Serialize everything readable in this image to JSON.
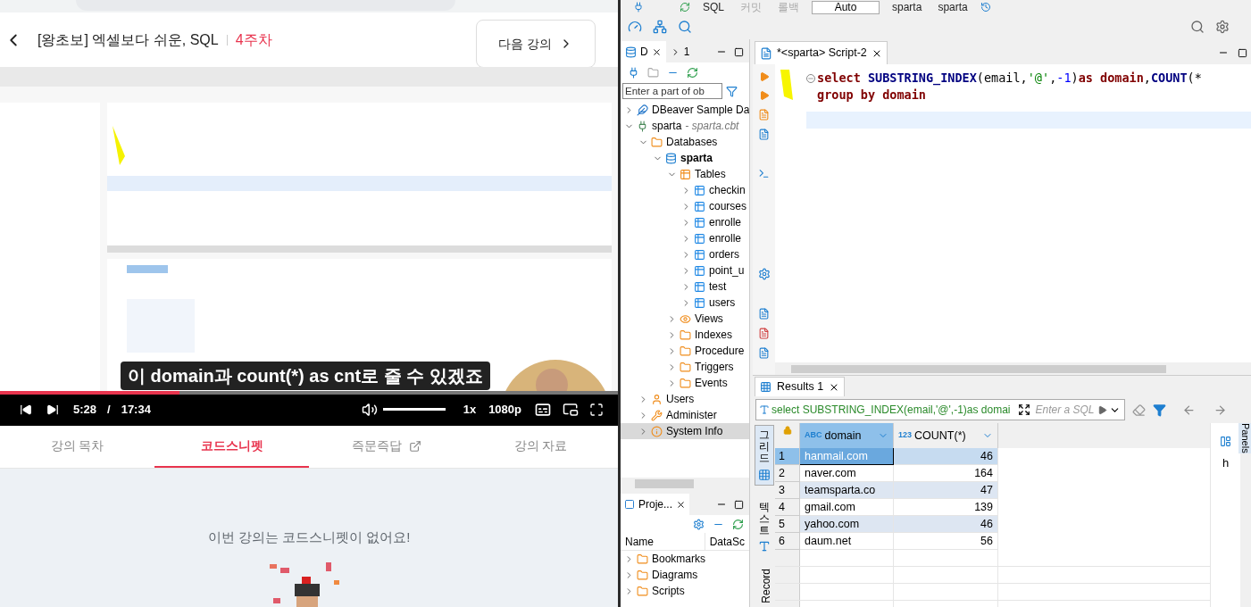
{
  "course_header": {
    "title": "[왕초보] 엑셀보다 쉬운, SQL",
    "week": "4주차",
    "next_button": "다음 강의"
  },
  "player": {
    "subtitle": "이 domain과 count(*) as cnt로 줄 수 있겠죠",
    "progress": {
      "level": 0.29
    },
    "current_time": "5:28",
    "separator": "/",
    "duration": "17:34",
    "volume": {
      "level": 1
    },
    "speed": "1x",
    "quality": "1080p"
  },
  "lecture_tabs": [
    {
      "label": "강의 목차",
      "selected": false,
      "external": false
    },
    {
      "label": "코드스니펫",
      "selected": true,
      "external": false
    },
    {
      "label": "즉문즉답",
      "selected": false,
      "external": true
    },
    {
      "label": "강의 자료",
      "selected": false,
      "external": false
    }
  ],
  "empty_message": "이번 강의는 코드스니펫이 없어요!",
  "dbeaver": {
    "toolbar": [
      {
        "label": "SQL",
        "kind": "button"
      },
      {
        "label": "커밋",
        "kind": "disabled"
      },
      {
        "label": "롤백",
        "kind": "disabled"
      },
      {
        "label": "Auto",
        "kind": "field"
      },
      {
        "label": "sparta",
        "kind": "button"
      },
      {
        "label": "sparta",
        "kind": "button"
      }
    ],
    "navigator": {
      "tabs": [
        {
          "label": "D",
          "selected": true
        },
        {
          "label": "1",
          "selected": false
        }
      ],
      "filter_placeholder": "Enter a part of ob",
      "tree": [
        {
          "label": "DBeaver Sample Da",
          "kind": "sample",
          "expanded": false,
          "selected": false
        },
        {
          "label": "sparta",
          "detail": "- sparta.cbt",
          "kind": "connection",
          "expanded": true,
          "selected": false,
          "children": [
            {
              "label": "Databases",
              "kind": "databases",
              "expanded": true,
              "selected": false,
              "children": [
                {
                  "label": "sparta",
                  "kind": "database",
                  "expanded": true,
                  "selected": false,
                  "children": [
                    {
                      "label": "Tables",
                      "kind": "tables",
                      "expanded": true,
                      "selected": false,
                      "children": [
                        {
                          "label": "checkin",
                          "kind": "table",
                          "expanded": false,
                          "selected": false
                        },
                        {
                          "label": "courses",
                          "kind": "table",
                          "expanded": false,
                          "selected": false
                        },
                        {
                          "label": "enrolle",
                          "kind": "table",
                          "expanded": false,
                          "selected": false
                        },
                        {
                          "label": "enrolle",
                          "kind": "table",
                          "expanded": false,
                          "selected": false
                        },
                        {
                          "label": "orders",
                          "kind": "table",
                          "expanded": false,
                          "selected": false
                        },
                        {
                          "label": "point_u",
                          "kind": "table",
                          "expanded": false,
                          "selected": false
                        },
                        {
                          "label": "test",
                          "kind": "table",
                          "expanded": false,
                          "selected": false
                        },
                        {
                          "label": "users",
                          "kind": "table",
                          "expanded": false,
                          "selected": false
                        }
                      ]
                    },
                    {
                      "label": "Views",
                      "kind": "views",
                      "expanded": false,
                      "selected": false
                    },
                    {
                      "label": "Indexes",
                      "kind": "folder",
                      "expanded": false,
                      "selected": false
                    },
                    {
                      "label": "Procedure",
                      "kind": "folder",
                      "expanded": false,
                      "selected": false
                    },
                    {
                      "label": "Triggers",
                      "kind": "folder",
                      "expanded": false,
                      "selected": false
                    },
                    {
                      "label": "Events",
                      "kind": "folder",
                      "expanded": false,
                      "selected": false
                    }
                  ]
                }
              ]
            },
            {
              "label": "Users",
              "kind": "users",
              "expanded": false,
              "selected": false
            },
            {
              "label": "Administer",
              "kind": "administer",
              "expanded": false,
              "selected": false
            },
            {
              "label": "System Info",
              "kind": "info",
              "expanded": false,
              "selected": true
            }
          ]
        }
      ]
    },
    "projects": {
      "tab": "Proje...",
      "columns": [
        "Name",
        "DataSc"
      ],
      "items": [
        {
          "label": "Bookmarks",
          "expanded": false
        },
        {
          "label": "Diagrams",
          "expanded": false
        },
        {
          "label": "Scripts",
          "expanded": false
        }
      ]
    },
    "editor": {
      "tab": "*<sparta> Script-2",
      "lines": [
        [
          {
            "text": "select ",
            "kind": "keyword"
          },
          {
            "text": "SUBSTRING_INDEX",
            "kind": "function"
          },
          {
            "text": "(email,",
            "kind": "plain"
          },
          {
            "text": "'@'",
            "kind": "string"
          },
          {
            "text": ",",
            "kind": "plain"
          },
          {
            "text": "-1",
            "kind": "number"
          },
          {
            "text": ")",
            "kind": "plain"
          },
          {
            "text": "as domain",
            "kind": "keyword"
          },
          {
            "text": ",",
            "kind": "plain"
          },
          {
            "text": "COUNT",
            "kind": "function"
          },
          {
            "text": "(*",
            "kind": "plain"
          }
        ],
        [
          {
            "text": "group by domain",
            "kind": "keyword"
          }
        ]
      ]
    },
    "results": {
      "tab": "Results 1",
      "query": "select SUBSTRING_INDEX(email,'@',-1)as domai",
      "filter_placeholder": "Enter a SQL",
      "columns": [
        {
          "type": "ABC",
          "label": "domain"
        },
        {
          "type": "123",
          "label": "COUNT(*)"
        }
      ],
      "rows": [
        {
          "index": "1",
          "domain": "hanmail.com",
          "count": "46",
          "selected": true
        },
        {
          "index": "2",
          "domain": "naver.com",
          "count": "164",
          "selected": false
        },
        {
          "index": "3",
          "domain": "teamsparta.co",
          "count": "47",
          "selected": false
        },
        {
          "index": "4",
          "domain": "gmail.com",
          "count": "139",
          "selected": false
        },
        {
          "index": "5",
          "domain": "yahoo.com",
          "count": "46",
          "selected": false
        },
        {
          "index": "6",
          "domain": "daum.net",
          "count": "56",
          "selected": false
        }
      ],
      "side_tabs": [
        {
          "label": "그리드",
          "kind": "grid",
          "selected": true
        },
        {
          "label": "텍스트",
          "kind": "text",
          "selected": false
        },
        {
          "label": "Record",
          "kind": "record",
          "selected": false
        }
      ],
      "value_preview": "h",
      "panels_tab": "Panels"
    }
  }
}
